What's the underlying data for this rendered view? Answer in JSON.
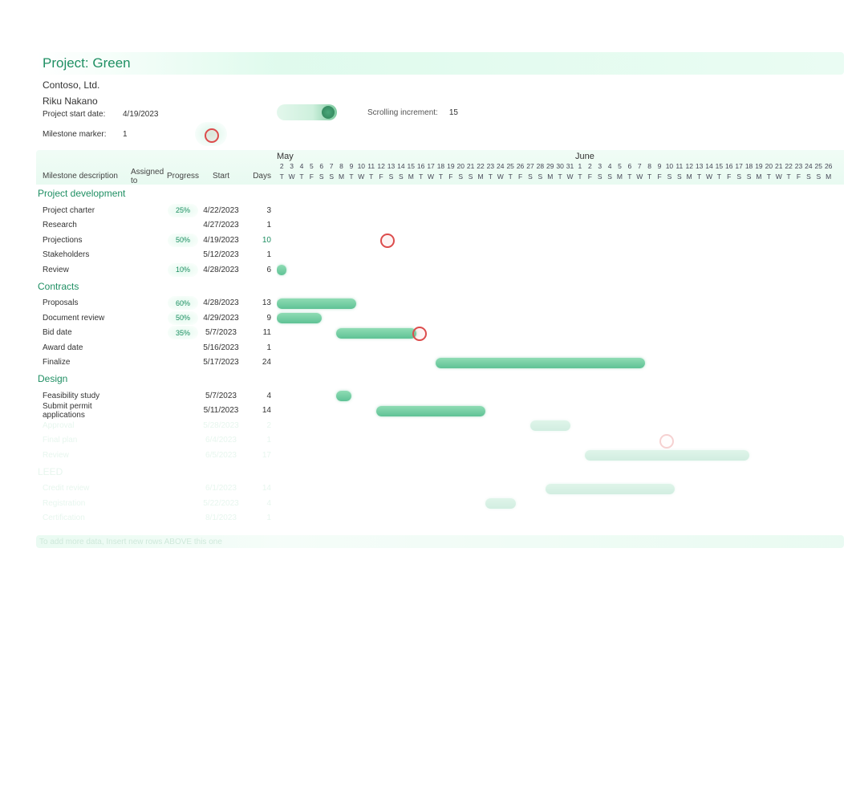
{
  "title": "Project: Green",
  "company": "Contoso, Ltd.",
  "lead": "Riku Nakano",
  "meta": {
    "start_label": "Project start date:",
    "start_value": "4/19/2023",
    "marker_label": "Milestone marker:",
    "marker_value": "1",
    "scroll_label": "Scrolling increment:",
    "scroll_value": "15"
  },
  "headers": {
    "milestone": "Milestone description",
    "assigned": "Assigned to",
    "progress": "Progress",
    "start": "Start",
    "days": "Days"
  },
  "months": [
    {
      "name": "May",
      "span_days": 30
    },
    {
      "name": "June",
      "span_days": 26
    }
  ],
  "timeline_day_numbers": [
    "2",
    "3",
    "4",
    "5",
    "6",
    "7",
    "8",
    "9",
    "10",
    "11",
    "12",
    "13",
    "14",
    "15",
    "16",
    "17",
    "18",
    "19",
    "20",
    "21",
    "22",
    "23",
    "24",
    "25",
    "26",
    "27",
    "28",
    "29",
    "30",
    "31",
    "1",
    "2",
    "3",
    "4",
    "5",
    "6",
    "7",
    "8",
    "9",
    "10",
    "11",
    "12",
    "13",
    "14",
    "15",
    "16",
    "17",
    "18",
    "19",
    "20",
    "21",
    "22",
    "23",
    "24",
    "25",
    "26"
  ],
  "timeline_day_letters": [
    "T",
    "W",
    "T",
    "F",
    "S",
    "S",
    "M",
    "T",
    "W",
    "T",
    "F",
    "S",
    "S",
    "M",
    "T",
    "W",
    "T",
    "F",
    "S",
    "S",
    "M",
    "T",
    "W",
    "T",
    "F",
    "S",
    "S",
    "M",
    "T",
    "W",
    "T",
    "F",
    "S",
    "S",
    "M",
    "T",
    "W",
    "T",
    "F",
    "S",
    "S",
    "M",
    "T",
    "W",
    "T",
    "F",
    "S",
    "S",
    "M",
    "T",
    "W",
    "T",
    "F",
    "S",
    "S",
    "M"
  ],
  "phases": [
    {
      "name": "Project development",
      "tasks": [
        {
          "desc": "Project charter",
          "progress": "25%",
          "start": "4/22/2023",
          "days": "3",
          "days_hl": false,
          "bar": null
        },
        {
          "desc": "Research",
          "progress": "",
          "start": "4/27/2023",
          "days": "1",
          "days_hl": false,
          "bar": null
        },
        {
          "desc": "Projections",
          "progress": "50%",
          "start": "4/19/2023",
          "days": "10",
          "days_hl": true,
          "bar": null,
          "marker_day": 11
        },
        {
          "desc": "Stakeholders",
          "progress": "",
          "start": "5/12/2023",
          "days": "1",
          "days_hl": false,
          "bar": null
        },
        {
          "desc": "Review",
          "progress": "10%",
          "start": "4/28/2023",
          "days": "6",
          "days_hl": false,
          "bar": {
            "offset": 0,
            "len": 1
          }
        }
      ]
    },
    {
      "name": "Contracts",
      "tasks": [
        {
          "desc": "Proposals",
          "progress": "60%",
          "start": "4/28/2023",
          "days": "13",
          "days_hl": false,
          "bar": {
            "offset": 0,
            "len": 8
          }
        },
        {
          "desc": "Document review",
          "progress": "50%",
          "start": "4/29/2023",
          "days": "9",
          "days_hl": false,
          "bar": {
            "offset": 0,
            "len": 4.5
          }
        },
        {
          "desc": "Bid date",
          "progress": "35%",
          "start": "5/7/2023",
          "days": "11",
          "days_hl": false,
          "bar": {
            "offset": 6,
            "len": 8
          },
          "marker_day": 14.2
        },
        {
          "desc": "Award date",
          "progress": "",
          "start": "5/16/2023",
          "days": "1",
          "days_hl": false,
          "bar": null
        },
        {
          "desc": "Finalize",
          "progress": "",
          "start": "5/17/2023",
          "days": "24",
          "days_hl": false,
          "bar": {
            "offset": 16,
            "len": 21
          }
        }
      ]
    },
    {
      "name": "Design",
      "tasks": [
        {
          "desc": "Feasibility study",
          "progress": "",
          "start": "5/7/2023",
          "days": "4",
          "days_hl": false,
          "bar": {
            "offset": 6,
            "len": 1.5
          }
        },
        {
          "desc": "Submit permit applications",
          "progress": "",
          "start": "5/11/2023",
          "days": "14",
          "days_hl": false,
          "bar": {
            "offset": 10,
            "len": 11
          }
        },
        {
          "desc": "Approval",
          "progress": "",
          "start": "5/28/2023",
          "days": "2",
          "days_hl": false,
          "bar": {
            "offset": 25.5,
            "len": 4
          },
          "faded": true
        },
        {
          "desc": "Final plan",
          "progress": "",
          "start": "6/4/2023",
          "days": "1",
          "days_hl": false,
          "bar": null,
          "faded": true,
          "marker_day": 39
        },
        {
          "desc": "Review",
          "progress": "",
          "start": "6/5/2023",
          "days": "17",
          "days_hl": false,
          "bar": {
            "offset": 31,
            "len": 16.5
          },
          "faded": true
        }
      ]
    },
    {
      "name": "LEED",
      "faded": true,
      "tasks": [
        {
          "desc": "Credit review",
          "progress": "",
          "start": "6/1/2023",
          "days": "14",
          "days_hl": false,
          "bar": {
            "offset": 27,
            "len": 13
          },
          "faded": true
        },
        {
          "desc": "Registration",
          "progress": "",
          "start": "5/22/2023",
          "days": "4",
          "days_hl": false,
          "bar": {
            "offset": 21,
            "len": 3
          },
          "faded": true
        },
        {
          "desc": "Certification",
          "progress": "",
          "start": "8/1/2023",
          "days": "1",
          "days_hl": false,
          "bar": null,
          "faded": true
        }
      ]
    }
  ],
  "footer": "To add more data, Insert new rows ABOVE this one"
}
